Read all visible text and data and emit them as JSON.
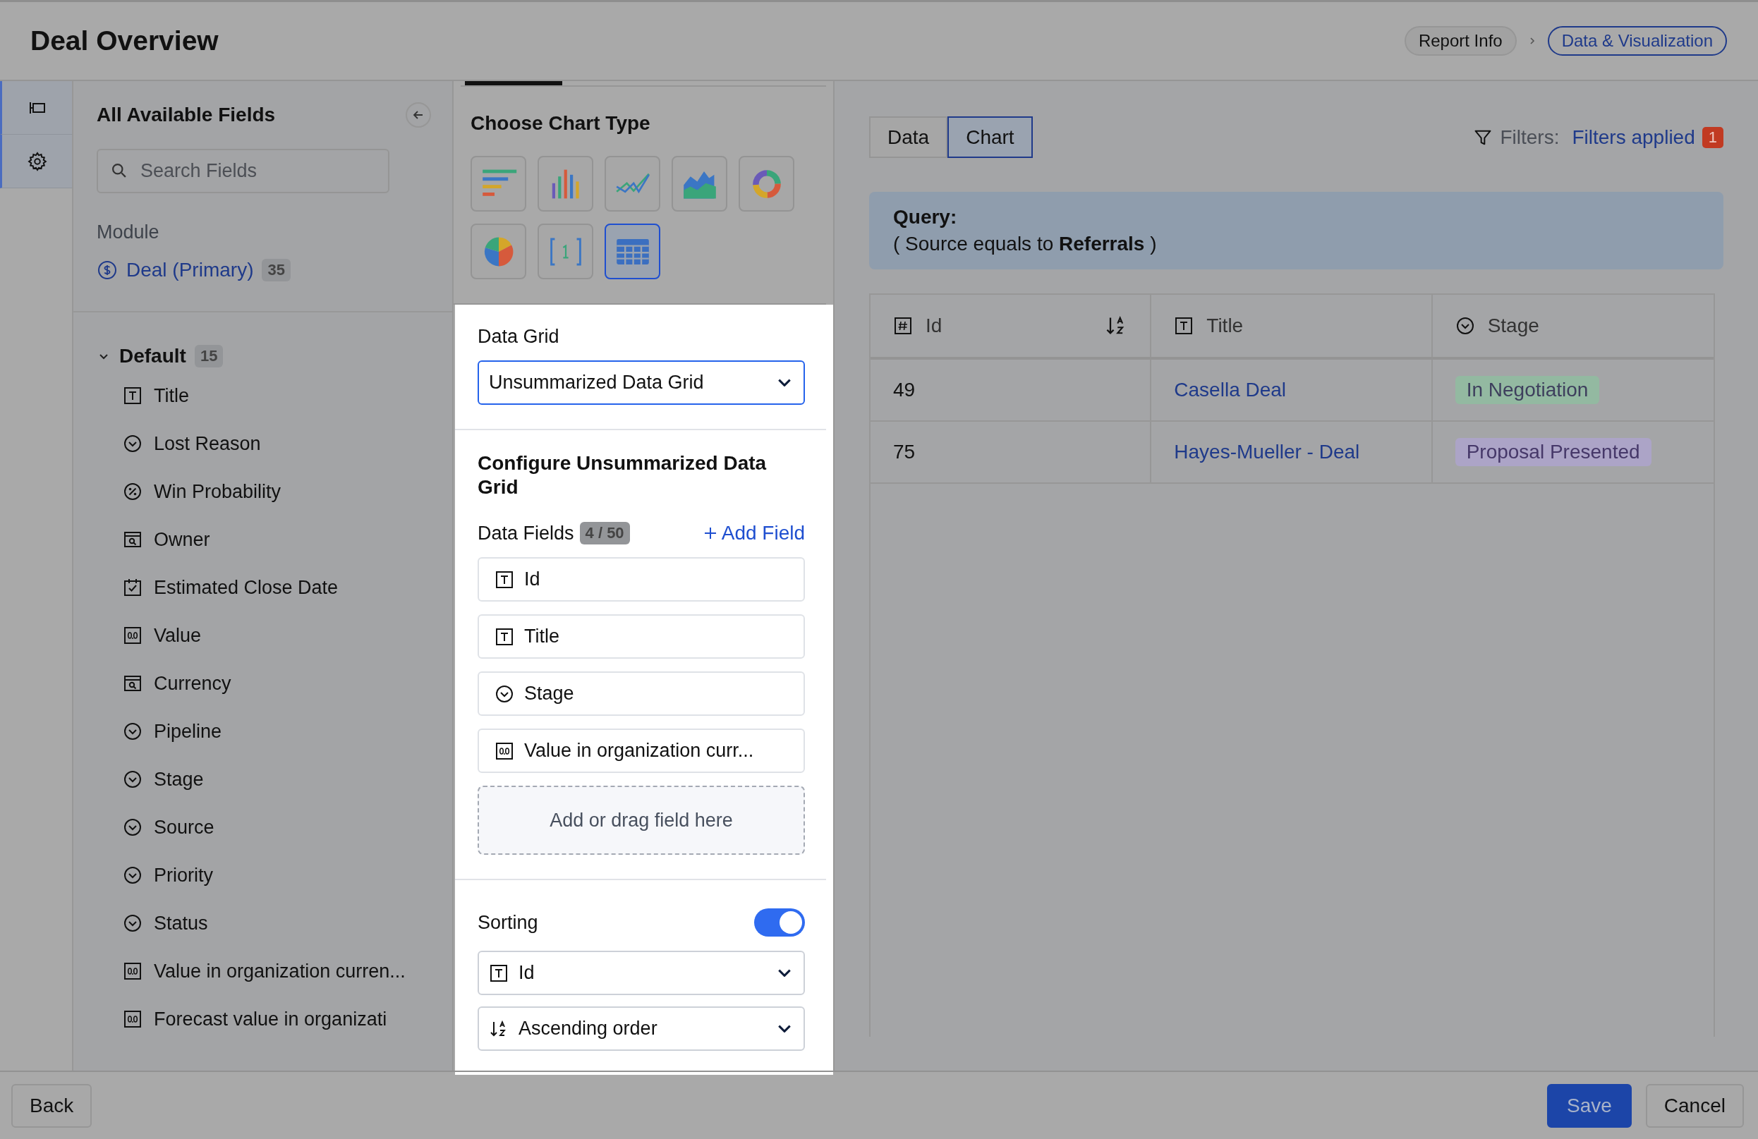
{
  "header": {
    "title": "Deal Overview",
    "breadcrumbs": [
      {
        "label": "Report Info",
        "selected": false
      },
      {
        "label": "Data & Visualization",
        "selected": true
      }
    ]
  },
  "fields_panel": {
    "title": "All Available Fields",
    "search": {
      "placeholder": "Search Fields"
    },
    "module_label": "Module",
    "module": {
      "name": "Deal (Primary)",
      "count": "35"
    },
    "group": {
      "name": "Default",
      "count": "15",
      "expanded": true,
      "items": [
        {
          "label": "Title",
          "kind": "text"
        },
        {
          "label": "Lost Reason",
          "kind": "select"
        },
        {
          "label": "Win Probability",
          "kind": "percent"
        },
        {
          "label": "Owner",
          "kind": "lookup"
        },
        {
          "label": "Estimated Close Date",
          "kind": "date"
        },
        {
          "label": "Value",
          "kind": "number"
        },
        {
          "label": "Currency",
          "kind": "lookup"
        },
        {
          "label": "Pipeline",
          "kind": "select"
        },
        {
          "label": "Stage",
          "kind": "select"
        },
        {
          "label": "Source",
          "kind": "select"
        },
        {
          "label": "Priority",
          "kind": "select"
        },
        {
          "label": "Status",
          "kind": "select"
        },
        {
          "label": "Value in organization curren...",
          "kind": "number"
        },
        {
          "label": "Forecast value in organizati",
          "kind": "number"
        }
      ]
    }
  },
  "chart_panel": {
    "title": "Choose Chart Type",
    "chart_types": [
      {
        "kind": "hbar",
        "selected": false
      },
      {
        "kind": "column",
        "selected": false
      },
      {
        "kind": "line",
        "selected": false
      },
      {
        "kind": "area",
        "selected": false
      },
      {
        "kind": "donut",
        "selected": false
      },
      {
        "kind": "pie",
        "selected": false
      },
      {
        "kind": "number",
        "selected": false
      },
      {
        "kind": "grid",
        "selected": true
      }
    ]
  },
  "config": {
    "data_grid": {
      "label": "Data Grid",
      "value": "Unsummarized Data Grid"
    },
    "configure_title": "Configure Unsummarized Data Grid",
    "data_fields": {
      "label": "Data Fields",
      "count": "4 / 50",
      "add": "Add Field",
      "items": [
        {
          "label": "Id",
          "kind": "text"
        },
        {
          "label": "Title",
          "kind": "text"
        },
        {
          "label": "Stage",
          "kind": "select"
        },
        {
          "label": "Value in organization curr...",
          "kind": "number"
        }
      ],
      "drop_hint": "Add or drag field here"
    },
    "sorting": {
      "label": "Sorting",
      "on": true,
      "field": {
        "label": "Id",
        "kind": "text"
      },
      "order": "Ascending order"
    }
  },
  "view_tabs": [
    {
      "label": "Data",
      "selected": false
    },
    {
      "label": "Chart",
      "selected": true
    }
  ],
  "filters": {
    "label": "Filters:",
    "link": "Filters applied",
    "count": "1"
  },
  "query": {
    "title": "Query:",
    "text": "( Source equals to **Referrals** )"
  },
  "table": {
    "columns": [
      {
        "label": "Id",
        "kind": "hash",
        "sorted": true
      },
      {
        "label": "Title",
        "kind": "text",
        "sorted": false
      },
      {
        "label": "Stage",
        "kind": "select",
        "sorted": false
      }
    ],
    "rows": [
      {
        "id": "49",
        "title": "Casella Deal",
        "stage": {
          "label": "In Negotiation",
          "color": "#93b9a1"
        }
      },
      {
        "id": "75",
        "title": "Hayes-Mueller - Deal",
        "stage": {
          "label": "Proposal Presented",
          "color": "#aca4c7"
        }
      }
    ]
  },
  "footer": {
    "back": "Back",
    "save": "Save",
    "cancel": "Cancel"
  }
}
